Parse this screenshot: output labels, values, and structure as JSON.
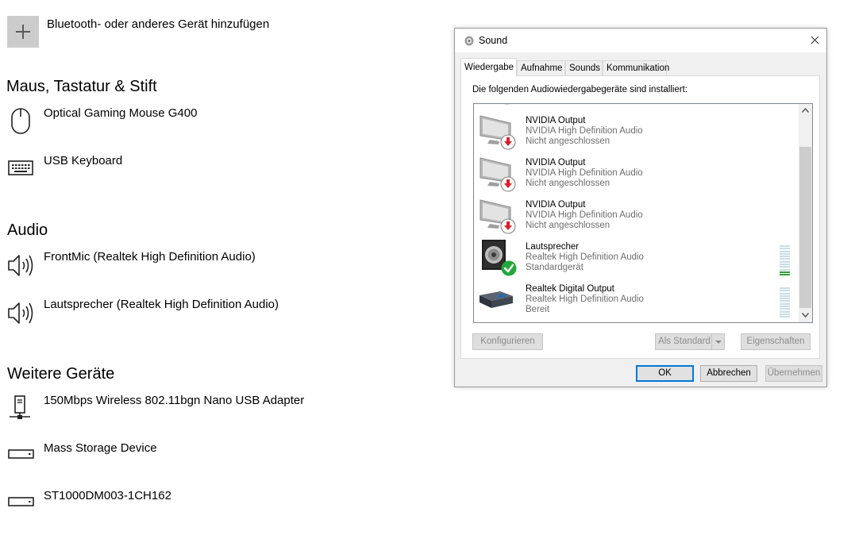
{
  "settings": {
    "add_device": {
      "label": "Bluetooth- oder anderes Gerät hinzufügen",
      "icon": "plus-icon"
    },
    "sections": [
      {
        "heading": "Maus, Tastatur & Stift",
        "devices": [
          {
            "name": "Optical Gaming Mouse G400",
            "icon": "mouse-icon"
          },
          {
            "name": "USB Keyboard",
            "icon": "keyboard-icon"
          }
        ]
      },
      {
        "heading": "Audio",
        "devices": [
          {
            "name": "FrontMic (Realtek High Definition Audio)",
            "icon": "speaker-icon"
          },
          {
            "name": "Lautsprecher (Realtek High Definition Audio)",
            "icon": "speaker-icon"
          }
        ]
      },
      {
        "heading": "Weitere Geräte",
        "devices": [
          {
            "name": "150Mbps Wireless 802.11bgn Nano USB Adapter",
            "icon": "network-adapter-icon"
          },
          {
            "name": "Mass Storage Device",
            "icon": "drive-icon"
          },
          {
            "name": "ST1000DM003-1CH162",
            "icon": "drive-icon"
          }
        ]
      }
    ]
  },
  "sound_dialog": {
    "title": "Sound",
    "tabs": [
      "Wiedergabe",
      "Aufnahme",
      "Sounds",
      "Kommunikation"
    ],
    "active_tab": "Wiedergabe",
    "panel_label": "Die folgenden Audiowiedergabegeräte sind installiert:",
    "devices": [
      {
        "name": "NVIDIA Output",
        "driver": "NVIDIA High Definition Audio",
        "status": "Nicht angeschlossen",
        "icon": "monitor-icon",
        "badge": "disconnected-badge"
      },
      {
        "name": "NVIDIA Output",
        "driver": "NVIDIA High Definition Audio",
        "status": "Nicht angeschlossen",
        "icon": "monitor-icon",
        "badge": "disconnected-badge"
      },
      {
        "name": "NVIDIA Output",
        "driver": "NVIDIA High Definition Audio",
        "status": "Nicht angeschlossen",
        "icon": "monitor-icon",
        "badge": "disconnected-badge"
      },
      {
        "name": "Lautsprecher",
        "driver": "Realtek High Definition Audio",
        "status": "Standardgerät",
        "icon": "speaker-device-icon",
        "badge": "default-check-badge",
        "level": 0.2
      },
      {
        "name": "Realtek Digital Output",
        "driver": "Realtek High Definition Audio",
        "status": "Bereit",
        "icon": "digital-output-icon",
        "level": 0
      }
    ],
    "buttons": {
      "configure": "Konfigurieren",
      "set_default": "Als Standard",
      "properties": "Eigenschaften",
      "ok": "OK",
      "cancel": "Abbrechen",
      "apply": "Übernehmen"
    },
    "colors": {
      "accent": "#0078d7",
      "disconnected": "#d9202a",
      "default_ok": "#22a83a",
      "meter_on": "#2e9f3b"
    }
  }
}
